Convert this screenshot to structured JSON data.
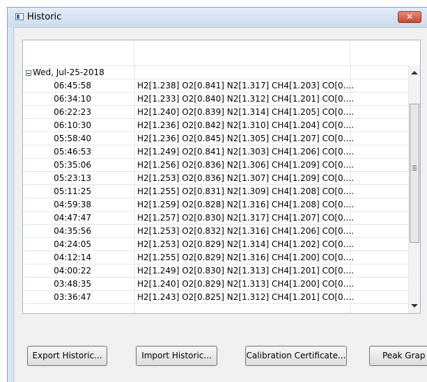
{
  "window": {
    "title": "Historic",
    "close_label": "✕"
  },
  "group": {
    "label": "Wed, Jul-25-2018"
  },
  "rows": [
    {
      "time": "06:45:58",
      "value": "H2[1.238] O2[0.841] N2[1.317] CH4[1.203] CO[0...."
    },
    {
      "time": "06:34:10",
      "value": "H2[1.233] O2[0.840] N2[1.312] CH4[1.201] CO[0...."
    },
    {
      "time": "06:22:23",
      "value": "H2[1.240] O2[0.839] N2[1.314] CH4[1.205] CO[0...."
    },
    {
      "time": "06:10:30",
      "value": "H2[1.236] O2[0.842] N2[1.310] CH4[1.204] CO[0...."
    },
    {
      "time": "05:58:40",
      "value": "H2[1.236] O2[0.845] N2[1.305] CH4[1.207] CO[0...."
    },
    {
      "time": "05:46:53",
      "value": "H2[1.249] O2[0.841] N2[1.303] CH4[1.206] CO[0...."
    },
    {
      "time": "05:35:06",
      "value": "H2[1.256] O2[0.836] N2[1.306] CH4[1.209] CO[0...."
    },
    {
      "time": "05:23:13",
      "value": "H2[1.253] O2[0.836] N2[1.307] CH4[1.209] CO[0...."
    },
    {
      "time": "05:11:25",
      "value": "H2[1.255] O2[0.831] N2[1.309] CH4[1.208] CO[0...."
    },
    {
      "time": "04:59:38",
      "value": "H2[1.259] O2[0.828] N2[1.316] CH4[1.208] CO[0...."
    },
    {
      "time": "04:47:47",
      "value": "H2[1.257] O2[0.830] N2[1.317] CH4[1.207] CO[0...."
    },
    {
      "time": "04:35:56",
      "value": "H2[1.253] O2[0.832] N2[1.316] CH4[1.206] CO[0...."
    },
    {
      "time": "04:24:05",
      "value": "H2[1.253] O2[0.829] N2[1.314] CH4[1.202] CO[0...."
    },
    {
      "time": "04:12:14",
      "value": "H2[1.255] O2[0.829] N2[1.316] CH4[1.200] CO[0...."
    },
    {
      "time": "04:00:22",
      "value": "H2[1.249] O2[0.830] N2[1.313] CH4[1.201] CO[0...."
    },
    {
      "time": "03:48:35",
      "value": "H2[1.240] O2[0.829] N2[1.313] CH4[1.200] CO[0...."
    },
    {
      "time": "03:36:47",
      "value": "H2[1.243] O2[0.825] N2[1.312] CH4[1.201] CO[0...."
    }
  ],
  "buttons": {
    "export": "Export Historic...",
    "import": "Import Historic...",
    "calibration": "Calibration Certificate...",
    "peak": "Peak Grap"
  },
  "colors": {
    "titlebar": "#d9e6f4",
    "close_button": "#c54a33"
  }
}
